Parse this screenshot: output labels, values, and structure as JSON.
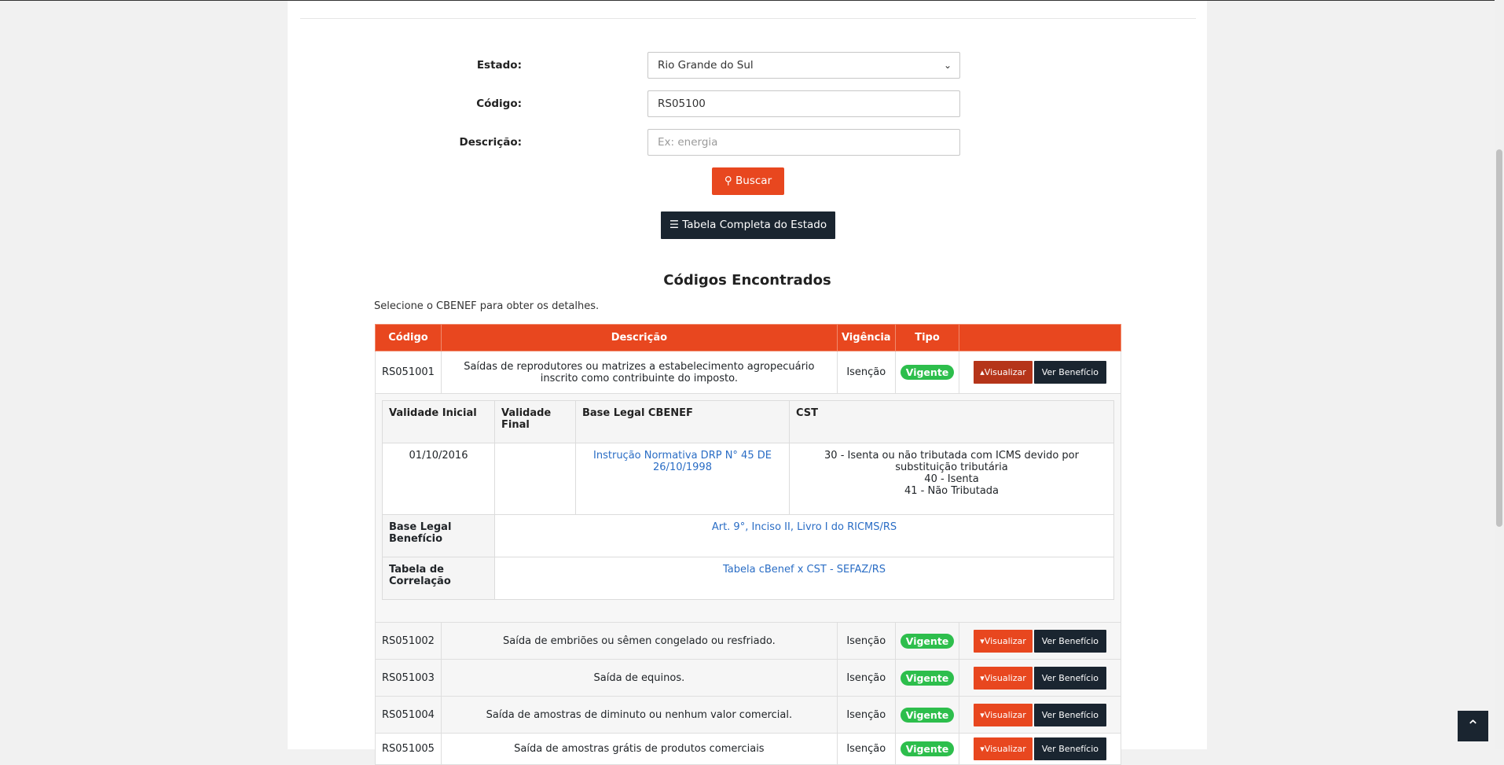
{
  "form": {
    "estado_label": "Estado:",
    "estado_value": "Rio Grande do Sul",
    "codigo_label": "Código:",
    "codigo_value": "RS05100",
    "descricao_label": "Descrição:",
    "descricao_placeholder": "Ex: energia",
    "buscar_label": "Buscar",
    "tabela_label": "Tabela Completa do Estado"
  },
  "results": {
    "title": "Códigos Encontrados",
    "helper": "Selecione o CBENEF para obter os detalhes.",
    "columns": [
      "Código",
      "Descrição",
      "Vigência",
      "Tipo",
      ""
    ],
    "rows": [
      {
        "code": "RS051001",
        "desc": "Saídas de reprodutores ou matrizes a estabelecimento agropecuário inscrito como contribuinte do imposto.",
        "vig": "Isenção",
        "tipo": "Vigente"
      },
      {
        "code": "RS051002",
        "desc": "Saída de embriões ou sêmen congelado ou resfriado.",
        "vig": "Isenção",
        "tipo": "Vigente"
      },
      {
        "code": "RS051003",
        "desc": "Saída de equinos.",
        "vig": "Isenção",
        "tipo": "Vigente"
      },
      {
        "code": "RS051004",
        "desc": "Saída de amostras de diminuto ou nenhum valor comercial.",
        "vig": "Isenção",
        "tipo": "Vigente"
      },
      {
        "code": "RS051005",
        "desc": "Saída de amostras grátis de produtos comerciais",
        "vig": "Isenção",
        "tipo": "Vigente"
      }
    ],
    "visualizar_label": "Visualizar",
    "ver_beneficio_label": "Ver Benefício",
    "detail": {
      "h_validade_inicial": "Validade Inicial",
      "h_validade_final": "Validade Final",
      "h_base_legal_cbenef": "Base Legal CBENEF",
      "h_cst": "CST",
      "validade_inicial": "01/10/2016",
      "validade_final": "",
      "base_legal_cbenef": "Instrução Normativa DRP N° 45 DE 26/10/1998",
      "cst_1": "30 - Isenta ou não tributada com ICMS devido por substituição tributária",
      "cst_2": "40 - Isenta",
      "cst_3": "41 - Não Tributada",
      "h_base_legal_beneficio": "Base Legal Benefício",
      "base_legal_beneficio": "Art. 9°, Inciso II, Livro I do RICMS/RS",
      "h_tabela_correlacao": "Tabela de Correlação",
      "tabela_correlacao": "Tabela cBenef x CST - SEFAZ/RS"
    }
  },
  "colors": {
    "accent": "#e8471f",
    "dark": "#1a2530",
    "success": "#2dbe4c",
    "link": "#2a6dc5"
  },
  "icons": {
    "search": "search-icon",
    "menu": "hamburger-icon",
    "caret_up": "caret-up-icon",
    "caret_down": "caret-down-icon",
    "select": "chevron-down-icon",
    "to_top": "chevron-up-icon"
  }
}
